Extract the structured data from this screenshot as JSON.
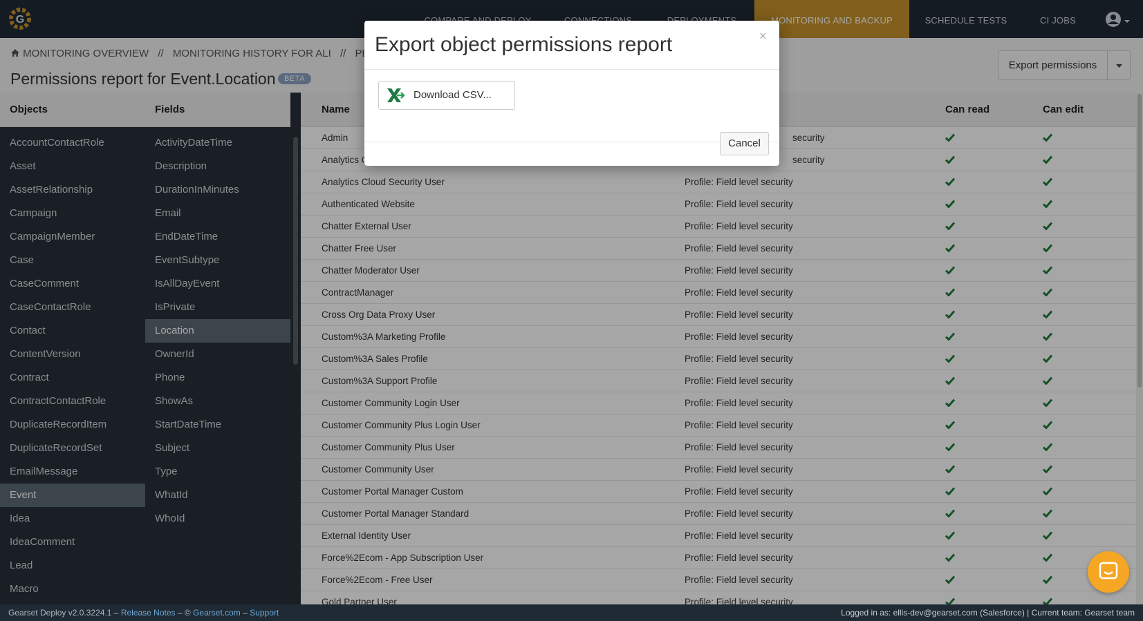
{
  "topbar": {
    "nav": [
      "COMPARE AND DEPLOY",
      "CONNECTIONS",
      "DEPLOYMENTS",
      "MONITORING AND BACKUP",
      "SCHEDULE TESTS",
      "CI JOBS"
    ],
    "active_nav": "MONITORING AND BACKUP"
  },
  "header": {
    "breadcrumb": [
      "MONITORING OVERVIEW",
      "MONITORING HISTORY FOR ALI",
      "PERMISSIO"
    ],
    "breadcrumb_sep": "//",
    "title": "Permissions report for Event.Location",
    "badge": "BETA",
    "export_button": "Export permissions"
  },
  "objects": {
    "header": "Objects",
    "items": [
      "AccountContactRole",
      "Asset",
      "AssetRelationship",
      "Campaign",
      "CampaignMember",
      "Case",
      "CaseComment",
      "CaseContactRole",
      "Contact",
      "ContentVersion",
      "Contract",
      "ContractContactRole",
      "DuplicateRecordItem",
      "DuplicateRecordSet",
      "EmailMessage",
      "Event",
      "Idea",
      "IdeaComment",
      "Lead",
      "Macro"
    ],
    "selected": "Event"
  },
  "fields": {
    "header": "Fields",
    "items": [
      "ActivityDateTime",
      "Description",
      "DurationInMinutes",
      "Email",
      "EndDateTime",
      "EventSubtype",
      "IsAllDayEvent",
      "IsPrivate",
      "Location",
      "OwnerId",
      "Phone",
      "ShowAs",
      "StartDateTime",
      "Subject",
      "Type",
      "WhatId",
      "WhoId"
    ],
    "selected": "Location"
  },
  "table": {
    "headers": {
      "name": "Name",
      "can_read": "Can read",
      "can_edit": "Can edit"
    },
    "rows": [
      {
        "name": "Admin",
        "source": "security"
      },
      {
        "name": "Analytics C",
        "source": "security"
      },
      {
        "name": "Analytics Cloud Security User",
        "source": "Profile: Field level security"
      },
      {
        "name": "Authenticated Website",
        "source": "Profile: Field level security"
      },
      {
        "name": "Chatter External User",
        "source": "Profile: Field level security"
      },
      {
        "name": "Chatter Free User",
        "source": "Profile: Field level security"
      },
      {
        "name": "Chatter Moderator User",
        "source": "Profile: Field level security"
      },
      {
        "name": "ContractManager",
        "source": "Profile: Field level security"
      },
      {
        "name": "Cross Org Data Proxy User",
        "source": "Profile: Field level security"
      },
      {
        "name": "Custom%3A Marketing Profile",
        "source": "Profile: Field level security"
      },
      {
        "name": "Custom%3A Sales Profile",
        "source": "Profile: Field level security"
      },
      {
        "name": "Custom%3A Support Profile",
        "source": "Profile: Field level security"
      },
      {
        "name": "Customer Community Login User",
        "source": "Profile: Field level security"
      },
      {
        "name": "Customer Community Plus Login User",
        "source": "Profile: Field level security"
      },
      {
        "name": "Customer Community Plus User",
        "source": "Profile: Field level security"
      },
      {
        "name": "Customer Community User",
        "source": "Profile: Field level security"
      },
      {
        "name": "Customer Portal Manager Custom",
        "source": "Profile: Field level security"
      },
      {
        "name": "Customer Portal Manager Standard",
        "source": "Profile: Field level security"
      },
      {
        "name": "External Identity User",
        "source": "Profile: Field level security"
      },
      {
        "name": "Force%2Ecom - App Subscription User",
        "source": "Profile: Field level security"
      },
      {
        "name": "Force%2Ecom - Free User",
        "source": "Profile: Field level security"
      },
      {
        "name": "Gold Partner User",
        "source": "Profile: Field level security"
      }
    ]
  },
  "modal": {
    "title": "Export object permissions report",
    "close": "×",
    "download_label": "Download CSV...",
    "cancel_label": "Cancel"
  },
  "footer": {
    "version": "Gearset Deploy v2.0.3224.1",
    "dash": "–",
    "release_notes": "Release Notes",
    "copyright": "©",
    "site": "Gearset.com",
    "support": "Support",
    "login_info": "Logged in as: ellis-dev@gearset.com (Salesforce) | Current team: Gearset team"
  },
  "colors": {
    "accent": "#c7922b",
    "topbar": "#1f2a35",
    "sidebar": "#273038",
    "check": "#1e7d3a",
    "chat": "#f5a623"
  }
}
